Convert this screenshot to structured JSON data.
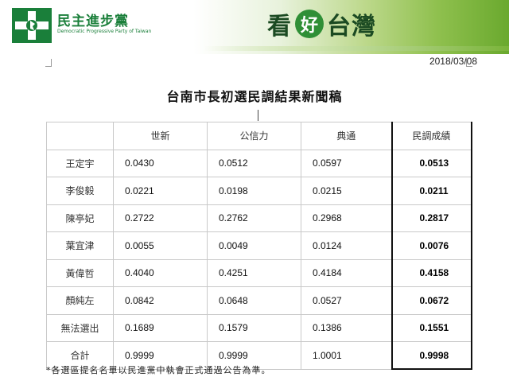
{
  "header": {
    "party_name": "民主進步黨",
    "party_name_en": "Democratic Progressive Party of Taiwan",
    "slogan": [
      "看",
      "好",
      "台灣"
    ],
    "colors": {
      "brand_green": "#1a7f3a",
      "dark_green": "#1b4a22",
      "accent_green": "#2f8f36"
    }
  },
  "date": "2018/03/08",
  "title": "台南市長初選民調結果新聞稿",
  "table": {
    "columns": [
      "",
      "世新",
      "公信力",
      "典通",
      "民調成績"
    ],
    "rows": [
      {
        "name": "王定宇",
        "values": [
          "0.0430",
          "0.0512",
          "0.0597"
        ],
        "result": "0.0513"
      },
      {
        "name": "李俊毅",
        "values": [
          "0.0221",
          "0.0198",
          "0.0215"
        ],
        "result": "0.0211"
      },
      {
        "name": "陳亭妃",
        "values": [
          "0.2722",
          "0.2762",
          "0.2968"
        ],
        "result": "0.2817"
      },
      {
        "name": "葉宜津",
        "values": [
          "0.0055",
          "0.0049",
          "0.0124"
        ],
        "result": "0.0076"
      },
      {
        "name": "黃偉哲",
        "values": [
          "0.4040",
          "0.4251",
          "0.4184"
        ],
        "result": "0.4158"
      },
      {
        "name": "顏純左",
        "values": [
          "0.0842",
          "0.0648",
          "0.0527"
        ],
        "result": "0.0672"
      },
      {
        "name": "無法選出",
        "values": [
          "0.1689",
          "0.1579",
          "0.1386"
        ],
        "result": "0.1551"
      },
      {
        "name": "合計",
        "values": [
          "0.9999",
          "0.9999",
          "1.0001"
        ],
        "result": "0.9998"
      }
    ]
  },
  "footnote": "*各選區提名名單以民進黨中執會正式通過公告為準。"
}
